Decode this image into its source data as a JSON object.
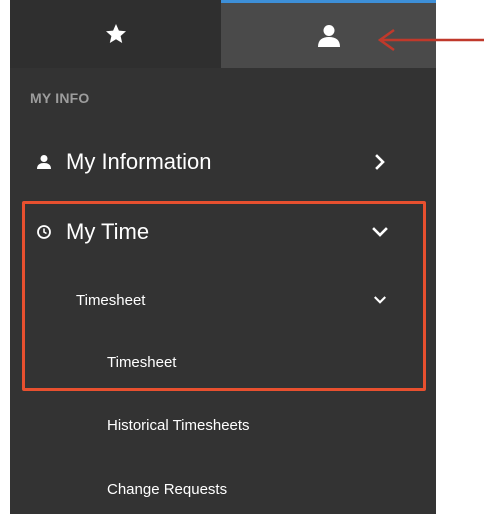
{
  "tabs": {
    "favorites_icon": "star-icon",
    "profile_icon": "user-icon",
    "active_color": "#3d8fd8"
  },
  "sidebar": {
    "section_header": "MY INFO",
    "items": [
      {
        "label": "My Information",
        "icon": "user-icon",
        "chevron": "chevron-right"
      },
      {
        "label": "My Time",
        "icon": "clock-icon",
        "chevron": "chevron-down"
      },
      {
        "label": "Timesheet",
        "chevron": "chevron-down"
      },
      {
        "label": "Timesheet"
      },
      {
        "label": "Historical Timesheets"
      },
      {
        "label": "Change Requests"
      }
    ]
  },
  "annotation": {
    "color": "#e8502f"
  }
}
